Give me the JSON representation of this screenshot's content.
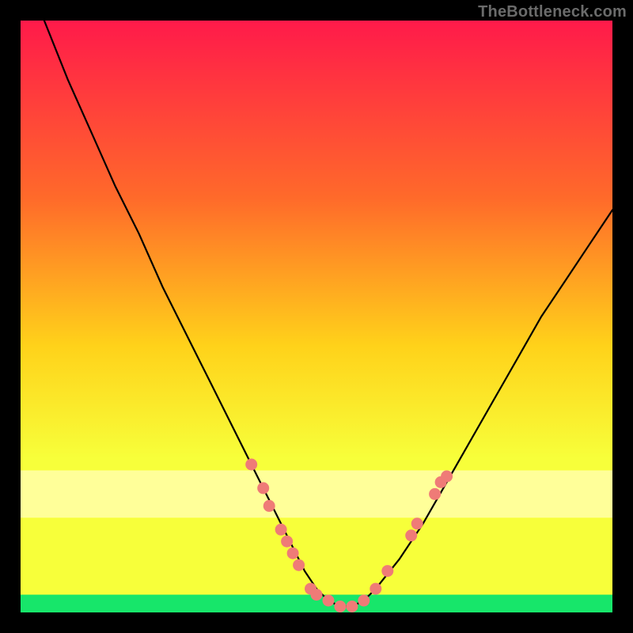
{
  "watermark": "TheBottleneck.com",
  "colors": {
    "frame": "#000000",
    "gradient_top": "#ff1a4a",
    "gradient_mid1": "#ff6a2a",
    "gradient_mid2": "#ffd21a",
    "gradient_mid3": "#f7ff3a",
    "gradient_band": "#ffff99",
    "gradient_bottom": "#17e66a",
    "curve": "#000000",
    "marker": "#ef7b77"
  },
  "chart_data": {
    "type": "line",
    "title": "",
    "xlabel": "",
    "ylabel": "",
    "xlim": [
      0,
      100
    ],
    "ylim": [
      0,
      100
    ],
    "series": [
      {
        "name": "bottleneck-curve",
        "x": [
          0,
          4,
          8,
          12,
          16,
          20,
          24,
          28,
          32,
          36,
          40,
          42,
          44,
          46,
          48,
          50,
          52,
          54,
          56,
          58,
          60,
          64,
          68,
          72,
          76,
          80,
          84,
          88,
          92,
          96,
          100
        ],
        "y": [
          110,
          100,
          90,
          81,
          72,
          64,
          55,
          47,
          39,
          31,
          23,
          19,
          15,
          11,
          7,
          4,
          2,
          1,
          1,
          2,
          4,
          9,
          15,
          22,
          29,
          36,
          43,
          50,
          56,
          62,
          68
        ]
      }
    ],
    "markers": {
      "name": "highlight-dots",
      "points": [
        {
          "x": 39,
          "y": 25
        },
        {
          "x": 41,
          "y": 21
        },
        {
          "x": 42,
          "y": 18
        },
        {
          "x": 44,
          "y": 14
        },
        {
          "x": 45,
          "y": 12
        },
        {
          "x": 46,
          "y": 10
        },
        {
          "x": 47,
          "y": 8
        },
        {
          "x": 49,
          "y": 4
        },
        {
          "x": 50,
          "y": 3
        },
        {
          "x": 52,
          "y": 2
        },
        {
          "x": 54,
          "y": 1
        },
        {
          "x": 56,
          "y": 1
        },
        {
          "x": 58,
          "y": 2
        },
        {
          "x": 60,
          "y": 4
        },
        {
          "x": 62,
          "y": 7
        },
        {
          "x": 66,
          "y": 13
        },
        {
          "x": 67,
          "y": 15
        },
        {
          "x": 70,
          "y": 20
        },
        {
          "x": 71,
          "y": 22
        },
        {
          "x": 72,
          "y": 23
        }
      ]
    },
    "bands": [
      {
        "name": "pale-yellow-band",
        "y0": 16,
        "y1": 24
      },
      {
        "name": "green-band",
        "y0": 0,
        "y1": 3
      }
    ]
  }
}
